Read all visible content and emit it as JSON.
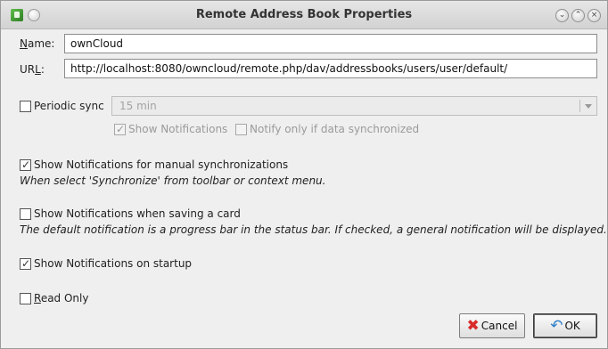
{
  "window": {
    "title": "Remote Address Book Properties"
  },
  "form": {
    "name_label_mnemonic": "N",
    "name_label_rest": "ame:",
    "name_value": "ownCloud",
    "url_label_first": "UR",
    "url_label_mnemonic": "L",
    "url_label_rest": ":",
    "url_value": "http://localhost:8080/owncloud/remote.php/dav/addressbooks/users/user/default/"
  },
  "periodic": {
    "label": "Periodic sync",
    "checked": false,
    "interval": "15 min",
    "show_notifications_label": "Show Notifications",
    "show_notifications_checked": true,
    "notify_only_label": "Notify only if data synchronized",
    "notify_only_checked": false
  },
  "options": {
    "manual_label": "Show Notifications for manual synchronizations",
    "manual_checked": true,
    "manual_desc": "When select 'Synchronize' from toolbar or context menu.",
    "saving_label": "Show Notifications when saving a card",
    "saving_checked": false,
    "saving_desc": "The default notification is a progress bar in the status bar. If checked, a general notification will be displayed.",
    "startup_label": "Show Notifications on startup",
    "startup_checked": true,
    "readonly_mnemonic": "R",
    "readonly_rest": "ead Only",
    "readonly_checked": false
  },
  "buttons": {
    "cancel": "Cancel",
    "ok": "OK"
  },
  "icons": {
    "app": "address-book-app-icon",
    "menu": "window-menu-icon",
    "minimize": "minimize-icon",
    "maximize": "maximize-icon",
    "close": "close-icon",
    "cancel": "red-x-icon",
    "ok": "ok-arrow-icon"
  },
  "check_glyph": "✓"
}
